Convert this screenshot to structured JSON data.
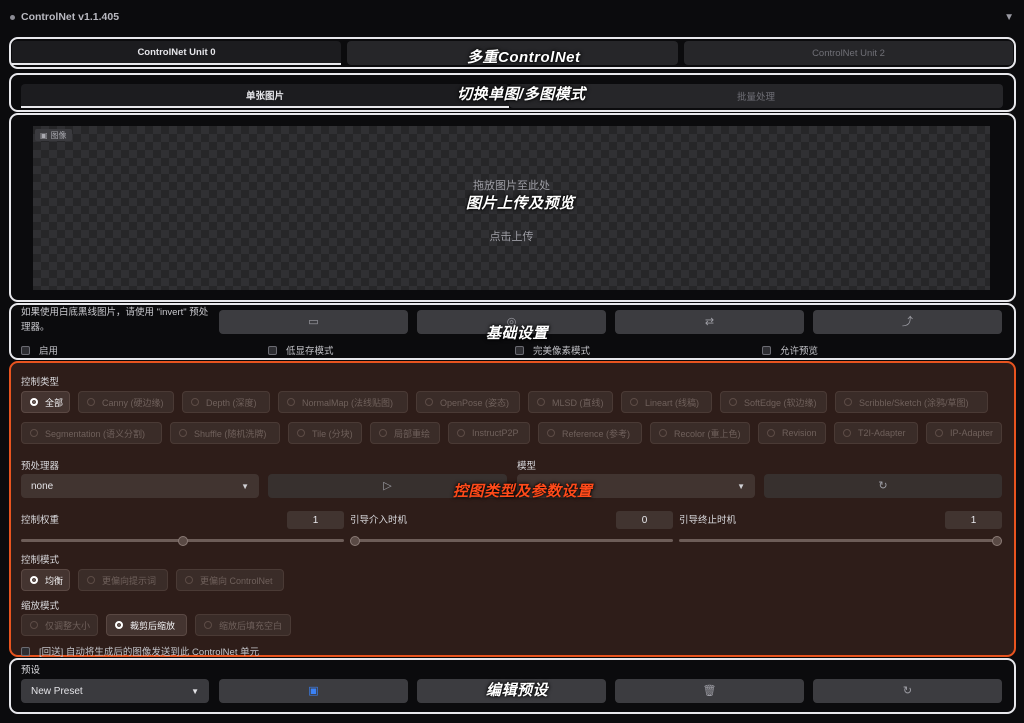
{
  "app": {
    "title": "ControlNet v1.1.405"
  },
  "units": {
    "tabs": [
      {
        "label": "ControlNet Unit 0",
        "active": true
      },
      {
        "label": "",
        "active": false
      },
      {
        "label": "ControlNet Unit 2",
        "active": false
      }
    ]
  },
  "mode_tabs": [
    {
      "label": "单张图片",
      "active": true
    },
    {
      "label": "批量处理",
      "active": false
    }
  ],
  "upload": {
    "badge": "图像",
    "drop_text": "拖放图片至此处",
    "click_text": "点击上传"
  },
  "basic": {
    "note": "如果使用白底黑线图片，请使用 \"invert\" 预处理器。",
    "checkboxes": [
      "启用",
      "低显存模式",
      "完美像素模式",
      "允许预览"
    ]
  },
  "control_type": {
    "label": "控制类型",
    "options": [
      "全部",
      "Canny (硬边缘)",
      "Depth (深度)",
      "NormalMap (法线贴图)",
      "OpenPose (姿态)",
      "MLSD (直线)",
      "Lineart (线稿)",
      "SoftEdge (软边缘)",
      "Scribble/Sketch (涂鸦/草图)",
      "Segmentation (语义分割)",
      "Shuffle (随机洗牌)",
      "Tile (分块)",
      "局部重绘",
      "InstructP2P",
      "Reference (参考)",
      "Recolor (重上色)",
      "Revision",
      "T2I-Adapter",
      "IP-Adapter"
    ],
    "selected": "全部"
  },
  "preprocessor": {
    "label": "预处理器",
    "value": "none"
  },
  "model": {
    "label": "模型"
  },
  "weights": {
    "control_weight": {
      "label": "控制权重",
      "value": "1",
      "fraction": 0.5
    },
    "start": {
      "label": "引导介入时机",
      "value": "0",
      "fraction": 0
    },
    "end": {
      "label": "引导终止时机",
      "value": "1",
      "fraction": 1
    }
  },
  "control_mode": {
    "label": "控制模式",
    "options": [
      "均衡",
      "更偏向提示词",
      "更偏向 ControlNet"
    ],
    "selected": "均衡"
  },
  "resize_mode": {
    "label": "缩放模式",
    "options": [
      "仅调整大小",
      "裁剪后缩放",
      "缩放后填充空白"
    ],
    "selected": "裁剪后缩放"
  },
  "loopback": {
    "label": "[回送] 自动将生成后的图像发送到此 ControlNet 单元"
  },
  "preset": {
    "label": "预设",
    "value": "New Preset"
  },
  "annotations": {
    "multi": "多重ControlNet",
    "switch": "切换单图/多图模式",
    "upload": "图片上传及预览",
    "basic": "基础设置",
    "control": "控图类型及参数设置",
    "preset": "编辑预设"
  },
  "colors": {
    "highlight_border": "#e8e8ec",
    "accent_orange": "#e9541f",
    "panel_brown": "#2e1d19"
  }
}
